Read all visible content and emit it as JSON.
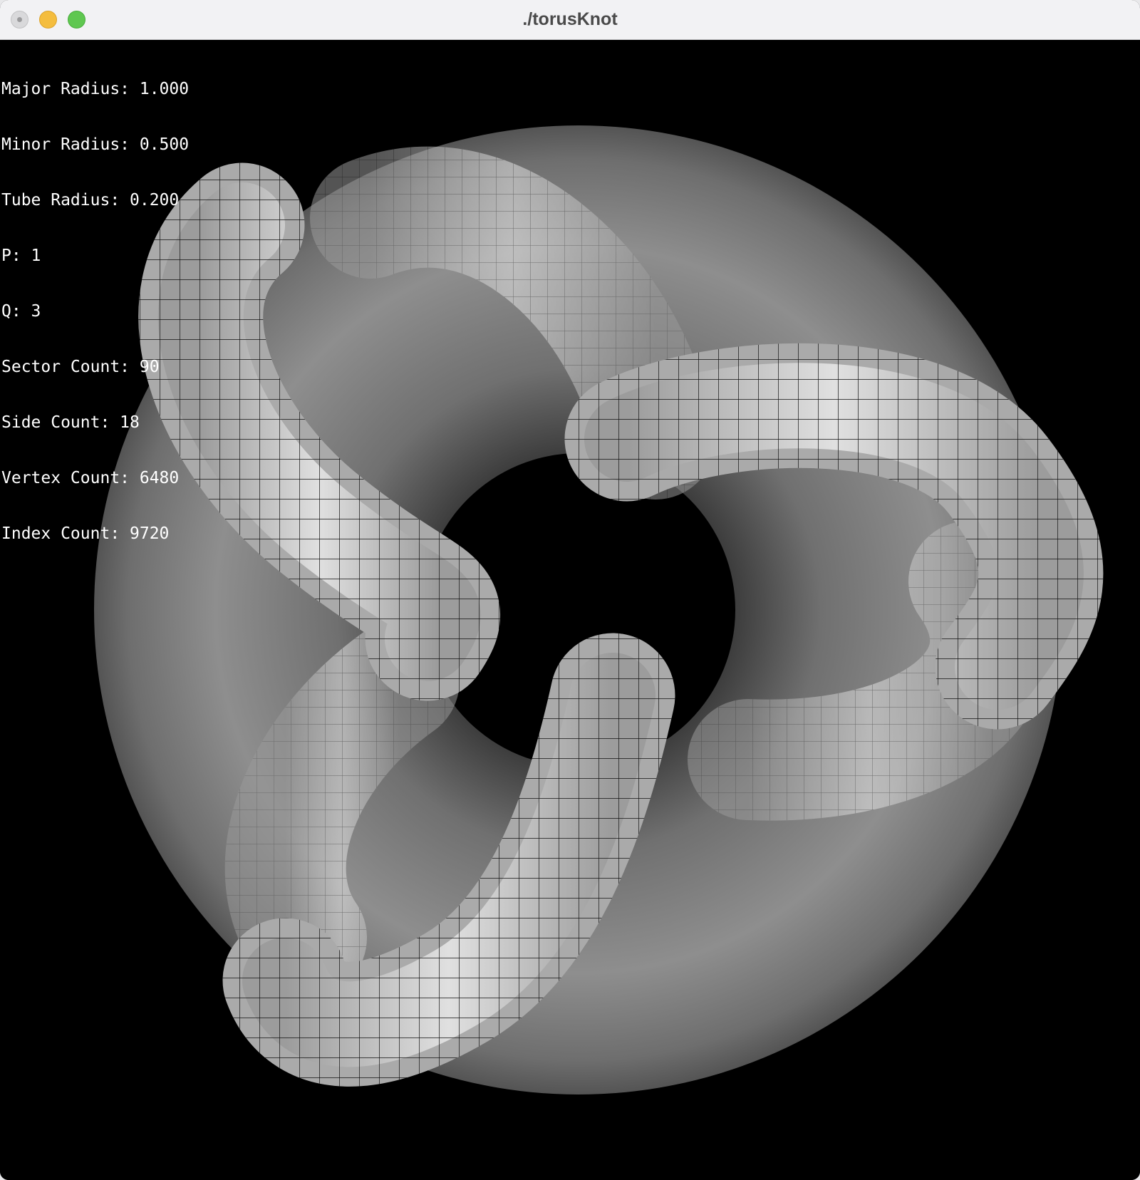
{
  "window": {
    "title": "./torusKnot"
  },
  "stats": {
    "lines": [
      "Major Radius: 1.000",
      "Minor Radius: 0.500",
      "Tube Radius: 0.200",
      "P: 1",
      "Q: 3",
      "Sector Count: 90",
      "Side Count: 18",
      "Vertex Count: 6480",
      "Index Count: 9720"
    ]
  },
  "colors": {
    "background": "#000000",
    "torus": "#8a8a8a",
    "knot": "#c8c8c8",
    "wire": "#000000"
  }
}
